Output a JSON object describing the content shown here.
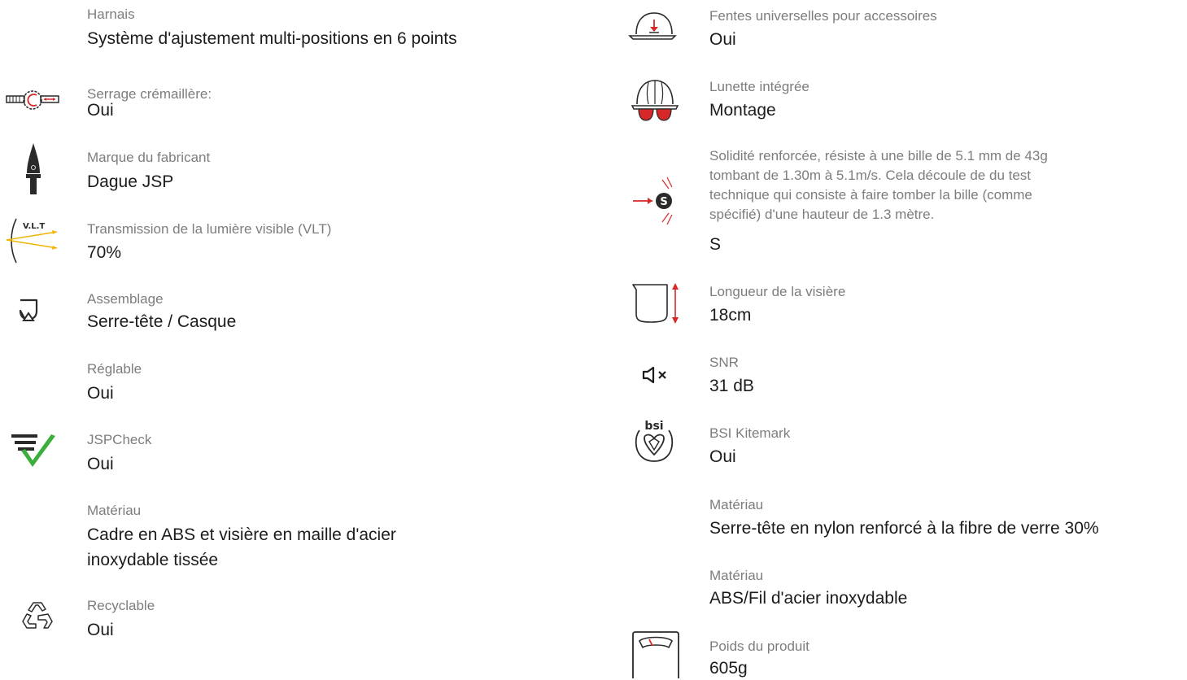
{
  "left": [
    {
      "icon": "",
      "label": "Harnais",
      "value": "Système d'ajustement multi-positions en 6 points"
    },
    {
      "icon": "ratchet-icon",
      "label": "Serrage crémaillère:",
      "value": "Oui"
    },
    {
      "icon": "dagger-icon",
      "label": "Marque du fabricant",
      "value": "Dague JSP"
    },
    {
      "icon": "vlt-icon",
      "label": "Transmission de la lumière visible (VLT)",
      "value": "70%",
      "icon_text": "V.L.T"
    },
    {
      "icon": "assembly-icon",
      "label": "Assemblage",
      "value": "Serre-tête / Casque"
    },
    {
      "icon": "",
      "label": "Réglable",
      "value": "Oui"
    },
    {
      "icon": "check-icon",
      "label": "JSPCheck",
      "value": "Oui"
    },
    {
      "icon": "",
      "label": "Matériau",
      "value_lines": [
        "Cadre en ABS et visière en maille d'acier",
        "inoxydable tissée"
      ]
    },
    {
      "icon": "recycle-icon",
      "label": "Recyclable",
      "value": "Oui"
    }
  ],
  "right": [
    {
      "icon": "helmet-slots-icon",
      "label": "Fentes universelles pour accessoires",
      "value": "Oui"
    },
    {
      "icon": "helmet-glasses-icon",
      "label": "Lunette intégrée",
      "value": "Montage"
    },
    {
      "icon": "impact-s-icon",
      "icon_text": "S",
      "label_lines": [
        "Solidité renforcée, résiste à une bille de 5.1 mm de 43g",
        "tombant de 1.30m à 5.1m/s. Cela découle de du test",
        "technique qui consiste à faire tomber la bille (comme",
        "spécifié) d'une hauteur de 1.3 mètre."
      ],
      "value": "S"
    },
    {
      "icon": "visor-length-icon",
      "label": "Longueur de la visière",
      "value": "18cm"
    },
    {
      "icon": "mute-icon",
      "label": "SNR",
      "value": "31 dB"
    },
    {
      "icon": "bsi-kitemark-icon",
      "icon_text": "bsi",
      "label": "BSI Kitemark",
      "value": "Oui"
    },
    {
      "icon": "",
      "label": "Matériau",
      "value": "Serre-tête en nylon renforcé à la fibre de verre 30%"
    },
    {
      "icon": "",
      "label": "Matériau",
      "value": "ABS/Fil d'acier inoxydable"
    },
    {
      "icon": "scale-icon",
      "label": "Poids du produit",
      "value": "605g"
    }
  ],
  "colors": {
    "accent_red": "#d62828",
    "check_green": "#3cae3c",
    "icon_dark": "#2a2a2a",
    "vlt_yellow": "#f0b400",
    "label_grey": "#7d7d7d"
  }
}
